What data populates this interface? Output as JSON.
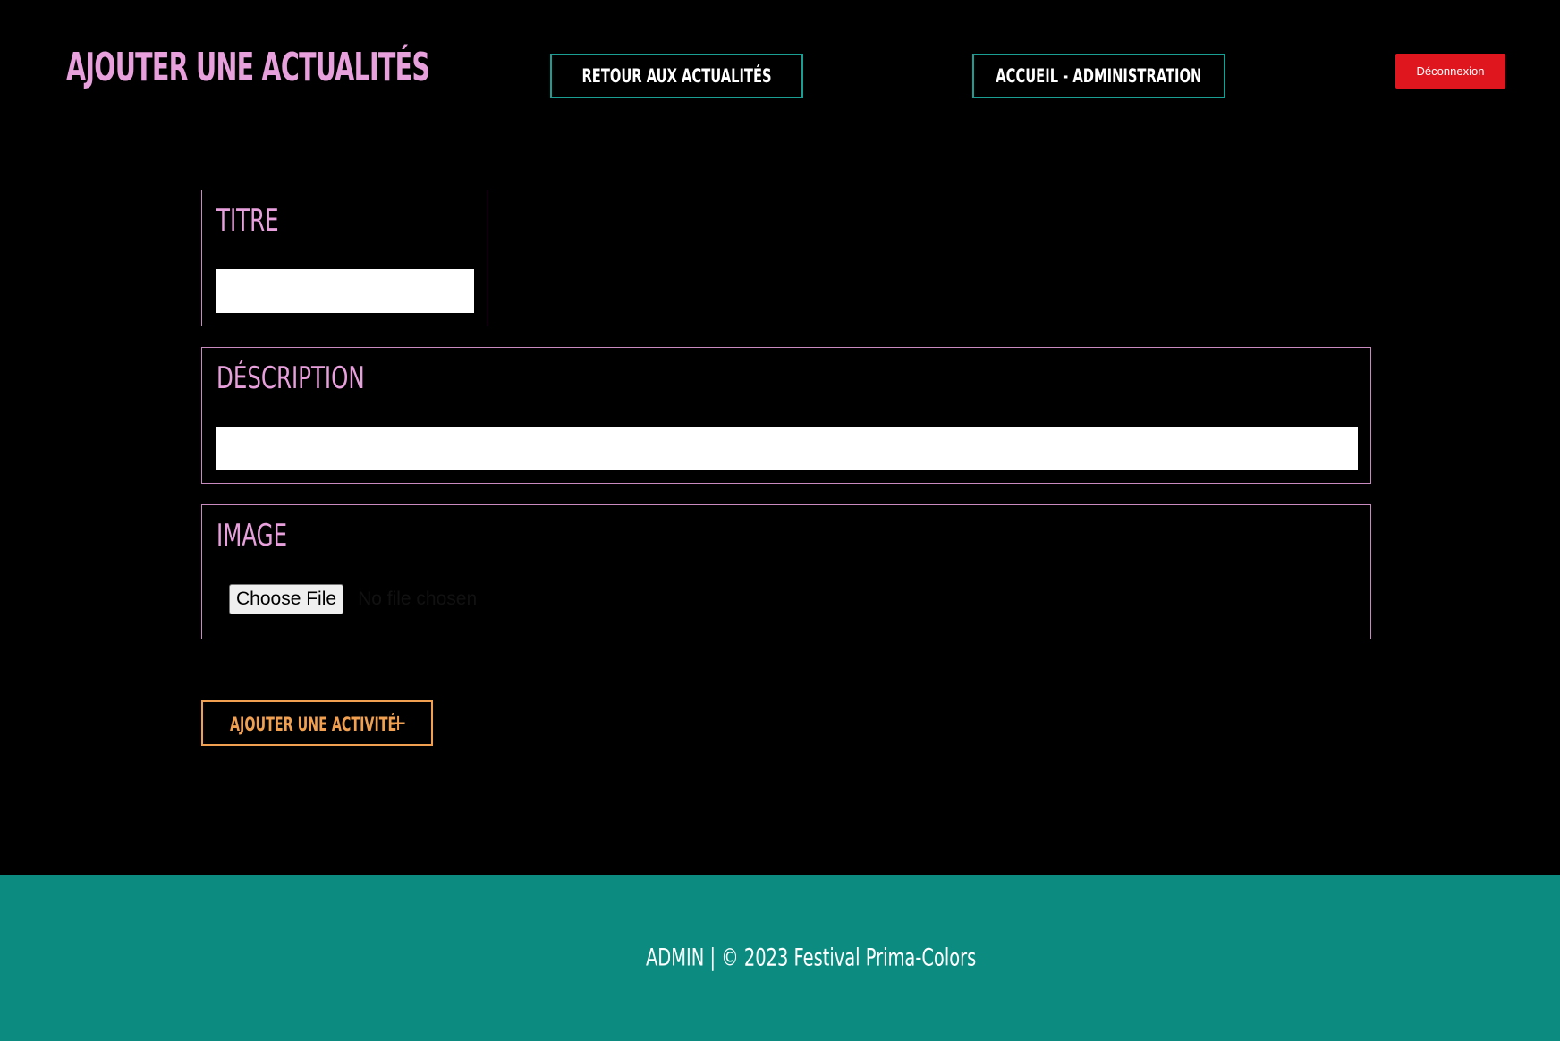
{
  "header": {
    "title": "AJOUTER UNE ACTUALITÉS",
    "back_label": "RETOUR AUX ACTUALITÉS",
    "home_label": "ACCUEIL - ADMINISTRATION",
    "logout_label": "Déconnexion"
  },
  "form": {
    "title_field": {
      "label": "TITRE",
      "value": ""
    },
    "description_field": {
      "label": "DÉSCRIPTION",
      "value": ""
    },
    "image_field": {
      "label": "IMAGE",
      "choose_label": "Choose File",
      "status": "No file chosen"
    },
    "submit_label": "AJOUTER UNE ACTIVITÉ",
    "submit_icon": "plus-icon"
  },
  "footer": {
    "text": "ADMIN | © 2023 Festival Prima-Colors"
  },
  "colors": {
    "background": "#000000",
    "accent_pink": "#e8a0dc",
    "accent_teal": "#1a9e94",
    "footer_teal": "#0c8c80",
    "logout_red": "#e0161e",
    "submit_orange": "#f0a050"
  }
}
